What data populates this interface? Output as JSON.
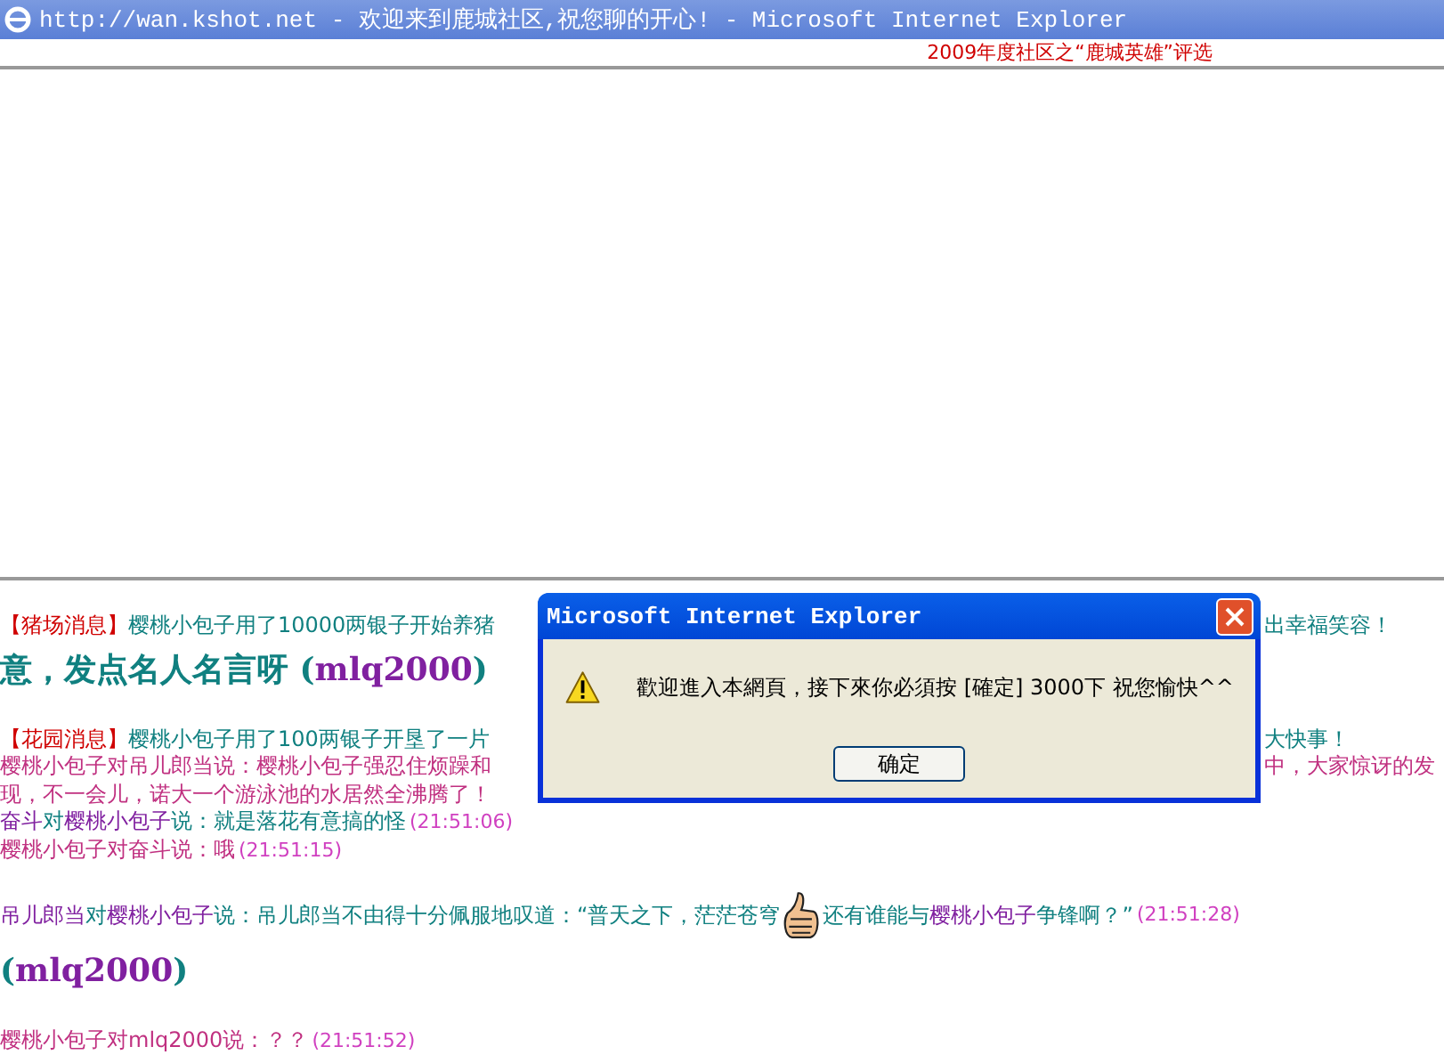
{
  "window": {
    "title": "http://wan.kshot.net - 欢迎来到鹿城社区,祝您聊的开心! - Microsoft Internet Explorer"
  },
  "top_frame": {
    "notice": "2009年度社区之“鹿城英雄”评选"
  },
  "chat": [
    {
      "kind": "line",
      "left": [
        {
          "kind": "tag",
          "text": "【猪场消息】"
        },
        {
          "kind": "notice",
          "text": "樱桃小包子用了10000两银子开始养猪"
        }
      ],
      "right": [
        {
          "kind": "notice",
          "text": "出幸福笑容！"
        }
      ]
    },
    {
      "kind": "banner",
      "left": [
        {
          "kind": "notice",
          "text": "意，发点名人名言呀 ("
        },
        {
          "kind": "name",
          "text": "mlq2000"
        },
        {
          "kind": "notice",
          "text": ")"
        }
      ]
    },
    {
      "kind": "gap"
    },
    {
      "kind": "line",
      "left": [
        {
          "kind": "tag",
          "text": "【花园消息】"
        },
        {
          "kind": "notice",
          "text": "樱桃小包子用了100两银子开垦了一片"
        }
      ],
      "right": [
        {
          "kind": "notice",
          "text": "大快事！"
        }
      ]
    },
    {
      "kind": "line",
      "left": [
        {
          "kind": "speech",
          "text": "樱桃小包子对吊儿郎当说：樱桃小包子强忍住烦躁和"
        }
      ],
      "right": [
        {
          "kind": "speech",
          "text": "中，大家惊讶的发"
        }
      ]
    },
    {
      "kind": "line",
      "left": [
        {
          "kind": "speech",
          "text": "现，不一会儿，诺大一个游泳池的水居然全沸腾了！"
        }
      ]
    },
    {
      "kind": "line",
      "left": [
        {
          "kind": "name",
          "text": "奋斗"
        },
        {
          "kind": "notice",
          "text": "对"
        },
        {
          "kind": "name",
          "text": "樱桃小包子"
        },
        {
          "kind": "notice",
          "text": "说：就是落花有意搞的怪"
        },
        {
          "kind": "time",
          "text": "(21:51:06)"
        }
      ]
    },
    {
      "kind": "line",
      "left": [
        {
          "kind": "speech",
          "text": "樱桃小包子对奋斗说：哦"
        },
        {
          "kind": "time",
          "text": "(21:51:15)"
        }
      ]
    },
    {
      "kind": "gap"
    },
    {
      "kind": "line",
      "left": [
        {
          "kind": "name",
          "text": "吊儿郎当"
        },
        {
          "kind": "notice",
          "text": "对"
        },
        {
          "kind": "name",
          "text": "樱桃小包子"
        },
        {
          "kind": "notice",
          "text": "说：吊儿郎当不由得十分佩服地叹道：“普天之下，茫茫苍穹"
        },
        {
          "kind": "emoji"
        },
        {
          "kind": "notice",
          "text": "还有谁能与"
        },
        {
          "kind": "name",
          "text": "樱桃小包子"
        },
        {
          "kind": "notice",
          "text": "争锋啊？”"
        },
        {
          "kind": "time",
          "text": "(21:51:28)"
        }
      ]
    },
    {
      "kind": "banner",
      "left": [
        {
          "kind": "notice",
          "text": "("
        },
        {
          "kind": "name",
          "text": "mlq2000"
        },
        {
          "kind": "notice",
          "text": ")"
        }
      ]
    },
    {
      "kind": "gap"
    },
    {
      "kind": "line",
      "left": [
        {
          "kind": "speech",
          "text": "樱桃小包子对mlq2000说：？？"
        },
        {
          "kind": "time",
          "text": "(21:51:52)"
        }
      ]
    }
  ],
  "dialog": {
    "title": "Microsoft Internet Explorer",
    "message": "歡迎進入本網頁，接下來你必須按 [確定] 3000下 祝您愉快^^",
    "button": "确定"
  }
}
